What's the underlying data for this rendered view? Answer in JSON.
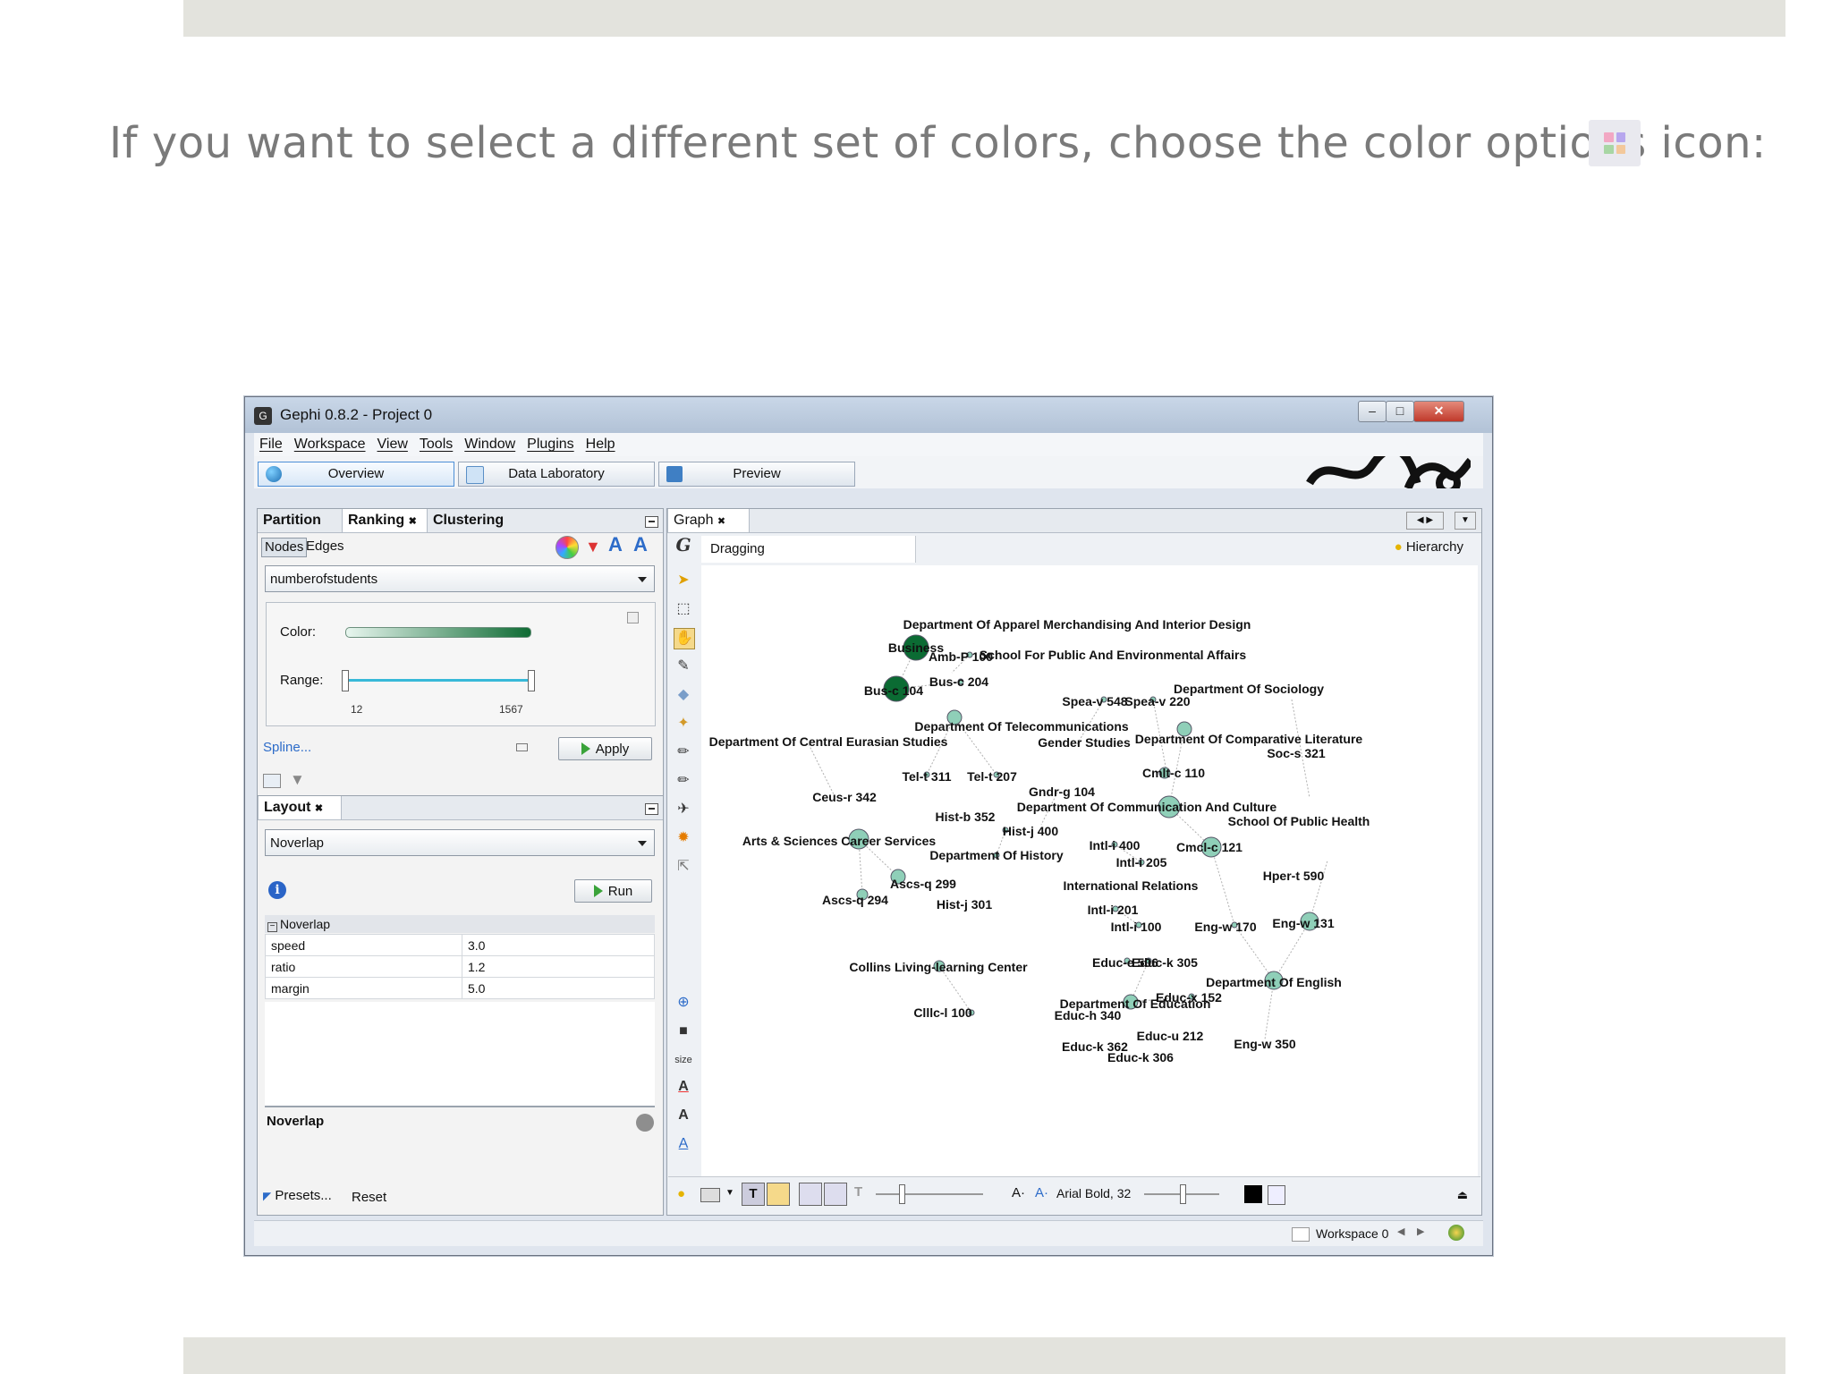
{
  "slide": {
    "instruction": "If you want to select a different set of colors, choose the color options icon:",
    "inline_icon": "color-options-icon"
  },
  "window": {
    "title": "Gephi 0.8.2 - Project 0",
    "controls": [
      "minimize-icon",
      "maximize-icon",
      "close-icon"
    ],
    "menu": [
      "File",
      "Workspace",
      "View",
      "Tools",
      "Window",
      "Plugins",
      "Help"
    ],
    "main_tabs": [
      "Overview",
      "Data Laboratory",
      "Preview"
    ]
  },
  "ranking_panel": {
    "tabs": [
      "Partition",
      "Ranking",
      "Clustering"
    ],
    "subtabs": [
      "Nodes",
      "Edges"
    ],
    "attribute": "numberofstudents",
    "color_label": "Color:",
    "range_label": "Range:",
    "range_min": "12",
    "range_max": "1567",
    "spline_link": "Spline...",
    "apply_label": "Apply",
    "gradient_start": "#e8f6ef",
    "gradient_end": "#0f6b34"
  },
  "layout_panel": {
    "title": "Layout",
    "algorithm": "Noverlap",
    "run_label": "Run",
    "section": "Noverlap",
    "properties": [
      {
        "name": "speed",
        "value": "3.0"
      },
      {
        "name": "ratio",
        "value": "1.2"
      },
      {
        "name": "margin",
        "value": "5.0"
      }
    ],
    "description_title": "Noverlap",
    "presets_label": "Presets...",
    "reset_label": "Reset"
  },
  "graph_panel": {
    "tab": "Graph",
    "mode": "Dragging",
    "hierarchy_label": "Hierarchy",
    "size_label": "size",
    "font_label": "Arial Bold, 32",
    "node_color_light": "#8fcfb8",
    "node_color_dark": "#0b6b33",
    "labels": [
      "Department Of Apparel Merchandising And Interior Design",
      "Business",
      "Amb-P 100",
      "School For Public And Environmental Affairs",
      "Bus-c 104",
      "Bus-c 204",
      "Spea-v 548",
      "Spea-v 220",
      "Department Of Sociology",
      "Department Of Telecommunications",
      "Department Of Central Eurasian Studies",
      "Gender Studies",
      "Department Of Comparative Literature",
      "Soc-s 321",
      "Tel-t 311",
      "Tel-t 207",
      "Gndr-g 104",
      "Cmlt-c 110",
      "Ceus-r 342",
      "Hist-b 352",
      "Department Of Communication And Culture",
      "Hist-j 400",
      "School Of Public Health",
      "Arts & Sciences Career Services",
      "Department Of History",
      "Intl-i 400",
      "Cmcl-c 121",
      "Intl-i 205",
      "Hper-t 590",
      "Ascs-q 299",
      "International Relations",
      "Ascs-q 294",
      "Hist-j 301",
      "Intl-i 201",
      "Intl-i 100",
      "Eng-w 170",
      "Eng-w 131",
      "Collins Living-learning Center",
      "Educ-e 506",
      "Educ-k 305",
      "Department Of English",
      "Educ-x 152",
      "Department Of Education",
      "Clllc-l 100",
      "Educ-h 340",
      "Educ-u 212",
      "Educ-k 362",
      "Eng-w 350",
      "Educ-k 306"
    ]
  },
  "statusbar": {
    "workspace": "Workspace 0"
  }
}
